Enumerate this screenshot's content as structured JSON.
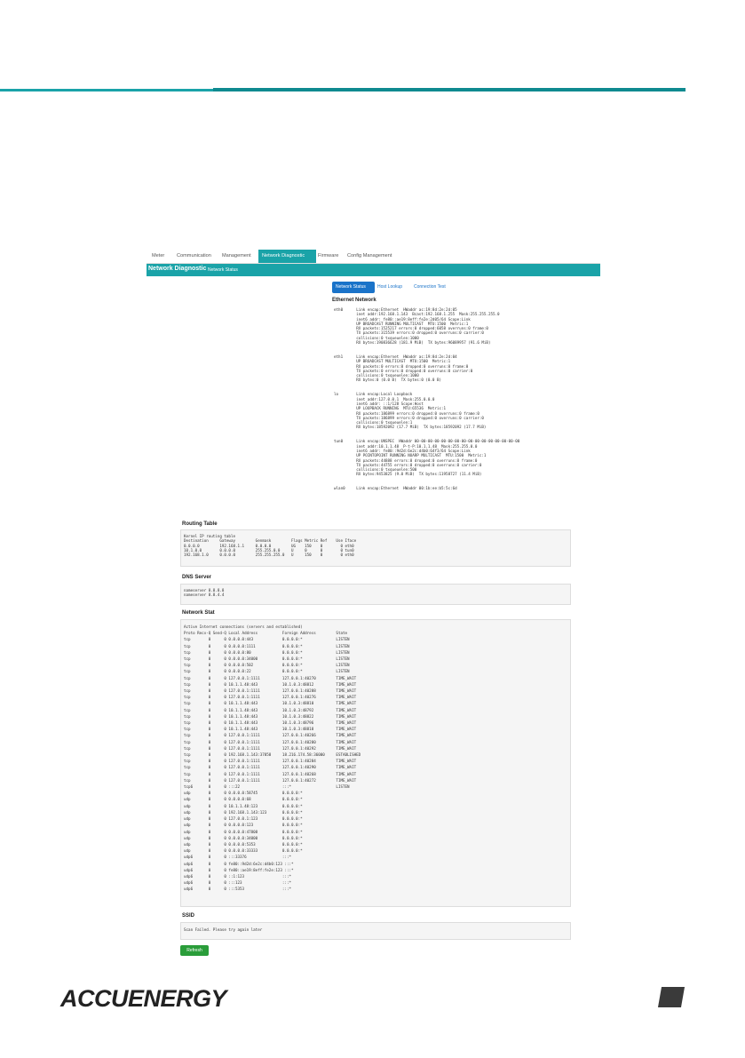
{
  "tabs": [
    "Meter",
    "Communication",
    "Management",
    "Network Diagnostic",
    "Firmware",
    "Config Management"
  ],
  "banner": {
    "title": "Network Diagnostic",
    "subtitle": "Network Status"
  },
  "subtabs": [
    "Network Status",
    "Host Lookup",
    "Connection Test"
  ],
  "sections": {
    "ethernet": "Ethernet Network",
    "routing": "Routing Table",
    "dns": "DNS Server",
    "netstat": "Network Stat",
    "ssid": "SSID"
  },
  "ethernet_text": "eth0      Link encap:Ethernet  HWaddr ac:19:8d:2e:2d:05\n          inet addr:192.168.1.143  Bcast:192.168.1.255  Mask:255.255.255.0\n          inet6 addr: fe80::ae19:8eff:fe2e:2d05/64 Scope:Link\n          UP BROADCAST RUNNING MULTICAST  MTU:1500  Metric:1\n          RX packets:1525217 errors:0 dropped:6058 overruns:0 frame:0\n          TX packets:315539 errors:0 dropped:0 overruns:0 carrier:0\n          collisions:0 txqueuelen:1000\n          RX bytes:190836628 (181.9 MiB)  TX bytes:96089957 (91.6 MiB)\n\n\neth1      Link encap:Ethernet  HWaddr ac:19:8d:2e:2d:04\n          UP BROADCAST MULTICAST  MTU:1500  Metric:1\n          RX packets:0 errors:0 dropped:0 overruns:0 frame:0\n          TX packets:0 errors:0 dropped:0 overruns:0 carrier:0\n          collisions:0 txqueuelen:1000\n          RX bytes:0 (0.0 B)  TX bytes:0 (0.0 B)\n\n\nlo        Link encap:Local Loopback\n          inet addr:127.0.0.1  Mask:255.0.0.0\n          inet6 addr: ::1/128 Scope:Host\n          UP LOOPBACK RUNNING  MTU:65536  Metric:1\n          RX packets:186899 errors:0 dropped:0 overruns:0 frame:0\n          TX packets:186899 errors:0 dropped:0 overruns:0 carrier:0\n          collisions:0 txqueuelen:1\n          RX bytes:18592092 (17.7 MiB)  TX bytes:18592092 (17.7 MiB)\n\n\ntun0      Link encap:UNSPEC  HWaddr 00-00-00-00-00-00-00-00-00-00-00-00-00-00-00-00\n          inet addr:10.1.1.48  P-t-P:10.1.1.48  Mask:255.255.0.0\n          inet6 addr: fe80::9d2d:6e2c:d4b0:64f3/64 Scope:Link\n          UP POINTOPOINT RUNNING NOARP MULTICAST  MTU:1500  Metric:1\n          RX packets:44888 errors:0 dropped:0 overruns:0 frame:0\n          TX packets:44755 errors:0 dropped:0 overruns:0 carrier:0\n          collisions:0 txqueuelen:500\n          RX bytes:9453825 (9.0 MiB)  TX bytes:11958727 (11.4 MiB)\n\n\nwlan0     Link encap:Ethernet  HWaddr 00:1b:ee:b5:5c:6d",
  "routing_text": "Kernel IP routing table\nDestination     Gateway         Genmask         Flags Metric Ref    Use Iface\n0.0.0.0         192.168.1.1     0.0.0.0         UG    150    0        0 eth0\n10.1.0.0        0.0.0.0         255.255.0.0     U     0      0        0 tun0\n192.168.1.0     0.0.0.0         255.255.255.0   U     150    0        0 eth0",
  "dns_text": "nameserver 8.8.8.8\nnameserver 8.8.4.4",
  "netstat_text": "Active Internet connections (servers and established)\nProto Recv-Q Send-Q Local Address           Foreign Address         State\ntcp        0      0 0.0.0.0:443             0.0.0.0:*               LISTEN\ntcp        0      0 0.0.0.0:1111            0.0.0.0:*               LISTEN\ntcp        0      0 0.0.0.0:80              0.0.0.0:*               LISTEN\ntcp        0      0 0.0.0.0:34000           0.0.0.0:*               LISTEN\ntcp        0      0 0.0.0.0:502             0.0.0.0:*               LISTEN\ntcp        0      0 0.0.0.0:22              0.0.0.0:*               LISTEN\ntcp        0      0 127.0.0.1:1111          127.0.0.1:40270         TIME_WAIT\ntcp        0      0 10.1.1.48:443           10.1.0.3:48812          TIME_WAIT\ntcp        0      0 127.0.0.1:1111          127.0.0.1:40288         TIME_WAIT\ntcp        0      0 127.0.0.1:1111          127.0.0.1:40276         TIME_WAIT\ntcp        0      0 10.1.1.48:443           10.1.0.3:48810          TIME_WAIT\ntcp        0      0 10.1.1.48:443           10.1.0.3:48792          TIME_WAIT\ntcp        0      0 10.1.1.48:443           10.1.0.3:48822          TIME_WAIT\ntcp        0      0 10.1.1.48:443           10.1.0.3:48796          TIME_WAIT\ntcp        0      0 10.1.1.48:443           10.1.0.3:48818          TIME_WAIT\ntcp        0      0 127.0.0.1:1111          127.0.0.1:40266         TIME_WAIT\ntcp        0      0 127.0.0.1:1111          127.0.0.1:40280         TIME_WAIT\ntcp        0      0 127.0.0.1:1111          127.0.0.1:40292         TIME_WAIT\ntcp        0      0 192.168.1.143:37858     18.216.174.58:36000     ESTABLISHED\ntcp        0      0 127.0.0.1:1111          127.0.0.1:40284         TIME_WAIT\ntcp        0      0 127.0.0.1:1111          127.0.0.1:40290         TIME_WAIT\ntcp        0      0 127.0.0.1:1111          127.0.0.1:40268         TIME_WAIT\ntcp        0      0 127.0.0.1:1111          127.0.0.1:40272         TIME_WAIT\ntcp6       0      0 :::22                   :::*                    LISTEN\nudp        0      0 0.0.0.0:58745           0.0.0.0:*\nudp        0      0 0.0.0.0:68              0.0.0.0:*\nudp        0      0 10.1.1.48:123           0.0.0.0:*\nudp        0      0 192.168.1.143:123       0.0.0.0:*\nudp        0      0 127.0.0.1:123           0.0.0.0:*\nudp        0      0 0.0.0.0:123             0.0.0.0:*\nudp        0      0 0.0.0.0:47808           0.0.0.0:*\nudp        0      0 0.0.0.0:34000           0.0.0.0:*\nudp        0      0 0.0.0.0:5353            0.0.0.0:*\nudp        0      0 0.0.0.0:33333           0.0.0.0:*\nudp6       0      0 :::33376                :::*\nudp6       0      0 fe80::9d2d:6e2c:d4b0:123 :::*\nudp6       0      0 fe80::ae19:8eff:fe2e:123 :::*\nudp6       0      0 ::1:123                 :::*\nudp6       0      0 :::123                  :::*\nudp6       0      0 :::5353                 :::*",
  "ssid_text": "Scan Failed. Please try again later",
  "refresh_label": "Refresh",
  "logo_text": "ACCUENERGY"
}
